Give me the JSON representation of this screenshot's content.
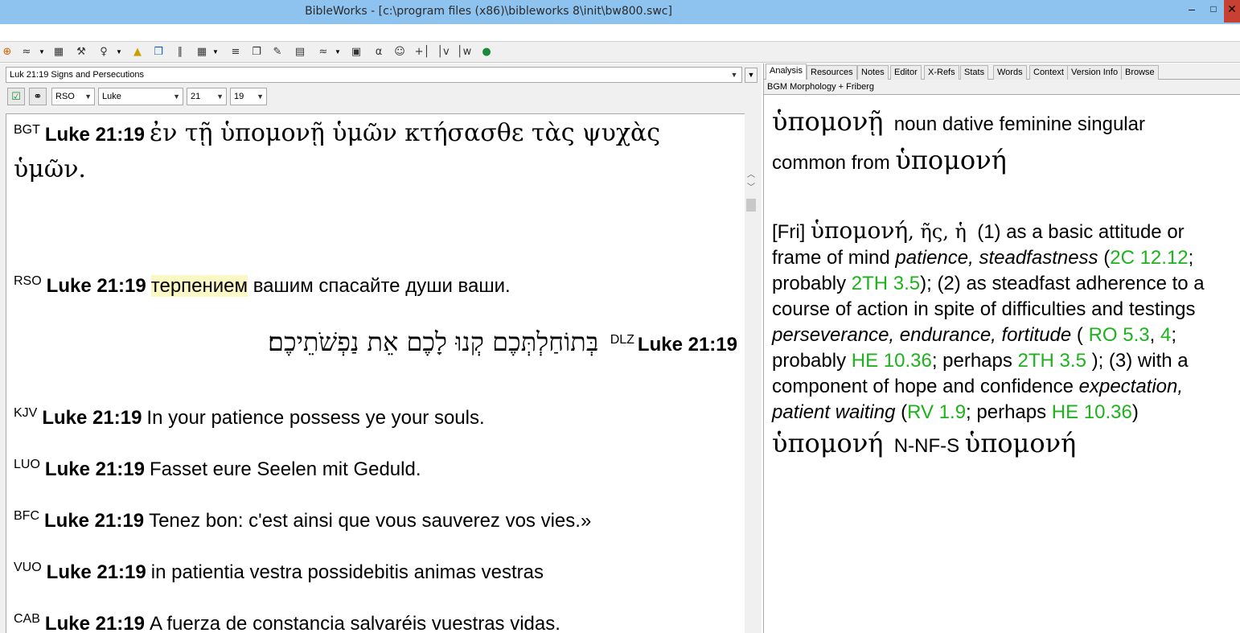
{
  "window": {
    "title": "BibleWorks - [c:\\program files (x86)\\bibleworks 8\\init\\bw800.swc]",
    "minimize": "–",
    "maximize": "□",
    "close": "✕"
  },
  "toolbar": {
    "icons": [
      "crosshair-icon",
      "search-icon",
      "browse-icon",
      "tools-icon",
      "stamp-icon",
      "highlight-icon",
      "windows-icon",
      "columns-icon",
      "layout-icon",
      "list-icon",
      "copy-icon",
      "edit-icon",
      "print-icon",
      "bookmark-icon",
      "grid-icon",
      "notes-icon",
      "person-icon",
      "add-icon",
      "ev-icon",
      "ew-icon",
      "globe-icon"
    ],
    "labels": [
      "⊕",
      "≈",
      "▦",
      "⚒",
      "♀",
      "▲",
      "❐",
      "∥",
      "▦",
      "≡",
      "❐",
      "✎",
      "▤",
      "≈",
      "▣",
      "α",
      "☺",
      "+│",
      "│v",
      "│w",
      "●"
    ]
  },
  "left": {
    "verse_title": "Luk 21:19 Signs and Persecutions",
    "version": "RSO",
    "book": "Luke",
    "chapter": "21",
    "verse": "19",
    "verses": {
      "bgt": {
        "abbr": "BGT",
        "ref": "Luke 21:19",
        "line1": "ἐν τῇ ὑπομονῇ ὑμῶν κτήσασθε τὰς ψυχὰς",
        "line2": "ὑμῶν."
      },
      "rso": {
        "abbr": "RSO",
        "ref": "Luke 21:19",
        "highlight": "терпением",
        "rest": " вашим спасайте души ваши."
      },
      "dlz": {
        "abbr": "DLZ",
        "ref": "Luke 21:19",
        "text": "בְּתוֹחַלְתְּכֶם קְנוּ לָכֶם אֵת נַפְשֹׁתֵיכֶם׃"
      },
      "kjv": {
        "abbr": "KJV",
        "ref": "Luke 21:19",
        "text": "In your patience possess ye your souls."
      },
      "luo": {
        "abbr": "LUO",
        "ref": "Luke 21:19",
        "text": "Fasset eure Seelen mit Geduld."
      },
      "bfc": {
        "abbr": "BFC",
        "ref": "Luke 21:19",
        "text": "Tenez bon: c'est ainsi que vous sauverez vos vies.»"
      },
      "vuo": {
        "abbr": "VUO",
        "ref": "Luke 21:19",
        "text": "in patientia vestra possidebitis animas vestras"
      },
      "cab": {
        "abbr": "CAB",
        "ref": "Luke 21:19",
        "text": "A fuerza de constancia salvaréis vuestras vidas."
      }
    }
  },
  "right": {
    "tabs": [
      "Analysis",
      "Resources",
      "Notes",
      "Editor",
      "X-Refs",
      "Stats",
      "Words",
      "Context",
      "Version Info",
      "Browse"
    ],
    "module": "BGM Morphology + Friberg",
    "entry": {
      "word": "ὑπομονῇ",
      "parse1": "noun dative feminine singular",
      "parse2": "common from",
      "lemma": "ὑπομονή",
      "fri_tag": "[Fri]",
      "fri_lemma": "ὑπομονή",
      "fri_forms": ", ῆς, ἡ",
      "d1": "(1) as a basic attitude or frame of mind ",
      "d1_gloss": "patience, steadfastness",
      "d1_open": " (",
      "ref_2c": "2C 12.12",
      "d1_prob": "; probably ",
      "ref_2th1": "2TH 3.5",
      "d2": "); (2) as steadfast adherence to a course of action in spite of difficulties and testings ",
      "d2_gloss": "perseverance, endurance, fortitude",
      "d2_open": " (",
      "ref_ro": "RO 5.3",
      "sep1": ", ",
      "ref_4": "4",
      "d2_prob": "; probably ",
      "ref_he1": "HE 10.36",
      "d2_perh": "; perhaps ",
      "ref_2th2": "2TH 3.5",
      "d3": "); (3) with a component of hope and confidence ",
      "d3_gloss": "expectation, patient waiting",
      "d3_open": " (",
      "ref_rv": "RV 1.9",
      "d3_perh": "; perhaps ",
      "ref_he2": "HE 10.36",
      "d3_close": ")",
      "code_word": "ὑπομονή",
      "code": "N-NF-S",
      "code_lemma": "ὑπομονή"
    }
  },
  "colors": {
    "titlebar": "#8ec3f0",
    "link": "#1eb21e",
    "highlight": "#fbf8c6",
    "close": "#c84031"
  }
}
